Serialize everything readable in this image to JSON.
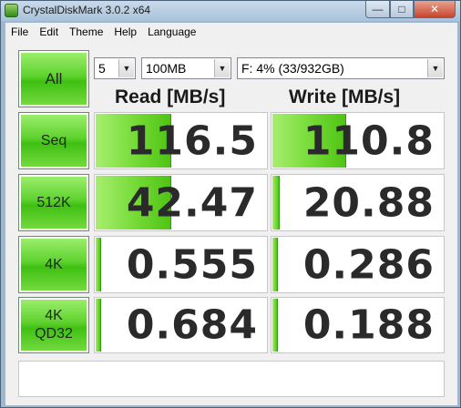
{
  "window": {
    "title": "CrystalDiskMark 3.0.2 x64",
    "minimize_label": "—",
    "maximize_label": "□",
    "close_label": "✕"
  },
  "menu": [
    "File",
    "Edit",
    "Theme",
    "Help",
    "Language"
  ],
  "controls": {
    "all_label": "All",
    "test_count": "5",
    "test_size": "100MB",
    "drive": "F: 4% (33/932GB)",
    "comment": ""
  },
  "headers": {
    "read": "Read [MB/s]",
    "write": "Write [MB/s]"
  },
  "rows": [
    {
      "label": "Seq",
      "read": "116.5",
      "write": "110.8",
      "read_fraction": 0.42,
      "write_fraction": 0.41
    },
    {
      "label": "512K",
      "read": "42.47",
      "write": "20.88",
      "read_fraction": 0.42,
      "write_fraction": 0.02
    },
    {
      "label": "4K",
      "read": "0.555",
      "write": "0.286",
      "read_fraction": 0.01,
      "write_fraction": 0.01
    },
    {
      "label_line1": "4K",
      "label_line2": "QD32",
      "read": "0.684",
      "write": "0.188",
      "read_fraction": 0.01,
      "write_fraction": 0.01
    }
  ],
  "colors": {
    "button_green": "#5fd22f",
    "bar_green": "#78dc3a"
  }
}
